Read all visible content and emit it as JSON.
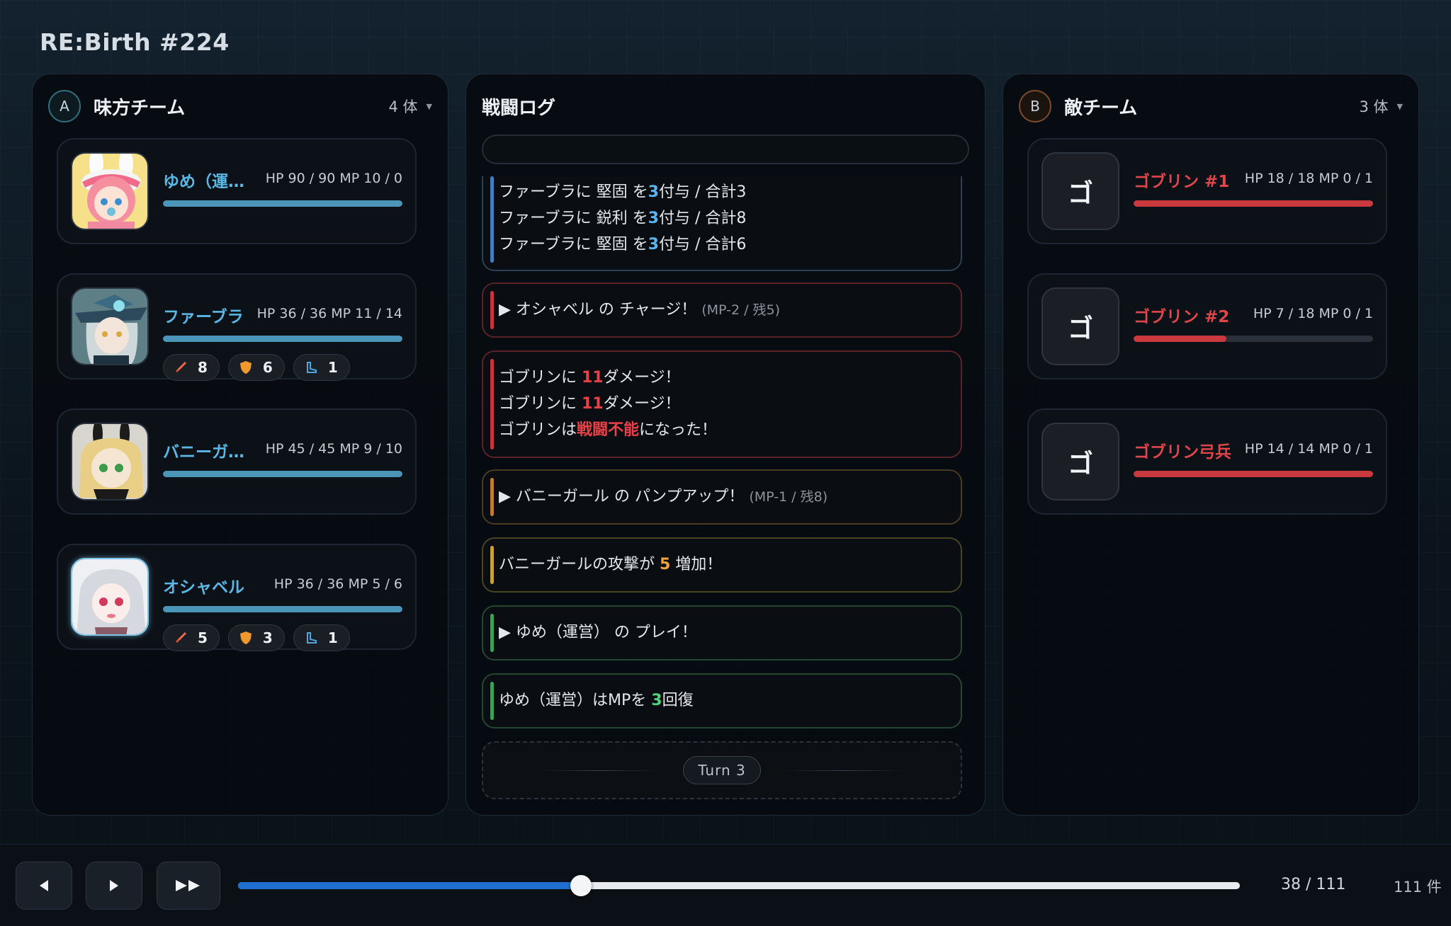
{
  "app": {
    "title": "RE:Birth #224"
  },
  "ally_team": {
    "badge": "A",
    "title": "味方チーム",
    "count": "4 体",
    "units": [
      {
        "name": "ゆめ（運…",
        "stats": "HP 90 / 90 MP 10 / 0",
        "hp_fraction": 1.0,
        "buffs": []
      },
      {
        "name": "ファーブラ",
        "stats": "HP 36 / 36 MP 11 / 14",
        "hp_fraction": 1.0,
        "buffs": [
          {
            "icon": "sword-icon",
            "value": "8"
          },
          {
            "icon": "shield-icon",
            "value": "6"
          },
          {
            "icon": "boot-icon",
            "value": "1"
          }
        ]
      },
      {
        "name": "バニーガ…",
        "stats": "HP 45 / 45 MP 9 / 10",
        "hp_fraction": 1.0,
        "buffs": []
      },
      {
        "name": "オシャベル",
        "stats": "HP 36 / 36 MP 5 / 6",
        "hp_fraction": 1.0,
        "buffs": [
          {
            "icon": "sword-icon",
            "value": "5"
          },
          {
            "icon": "shield-icon",
            "value": "3"
          },
          {
            "icon": "boot-icon",
            "value": "1"
          }
        ]
      }
    ]
  },
  "enemy_team": {
    "badge": "B",
    "title": "敵チーム",
    "count": "3 体",
    "units": [
      {
        "portrait_glyph": "ゴ",
        "name": "ゴブリン #1",
        "stats": "HP 18 / 18 MP 0 / 1",
        "hp_fraction": 1.0
      },
      {
        "portrait_glyph": "ゴ",
        "name": "ゴブリン #2",
        "stats": "HP 7 / 18 MP 0 / 1",
        "hp_fraction": 0.389
      },
      {
        "portrait_glyph": "ゴ",
        "name": "ゴブリン弓兵",
        "stats": "HP 14 / 14 MP 0 / 1",
        "hp_fraction": 1.0
      }
    ]
  },
  "battle_log": {
    "title": "戦闘ログ",
    "entries": [
      {
        "lines": [
          [
            "ファーブラに 堅固 を",
            "3",
            "付与 / 合計3"
          ],
          [
            "ファーブラに 鋭利 を",
            "3",
            "付与 / 合計8"
          ],
          [
            "ファーブラに 堅固 を",
            "3",
            "付与 / 合計6"
          ]
        ]
      },
      {
        "prefix": "▶ オシャベル の チャージ！",
        "note": "(MP-2 / 残5)"
      },
      {
        "lines": [
          [
            "ゴブリンに ",
            "11",
            "ダメージ！"
          ],
          [
            "ゴブリンに ",
            "11",
            "ダメージ！"
          ],
          [
            "ゴブリンは",
            "戦闘不能",
            "になった！"
          ]
        ]
      },
      {
        "prefix": "▶ バニーガール の パンプアップ！",
        "note": "(MP-1 / 残8)"
      },
      {
        "line": [
          "バニーガールの攻撃が ",
          "5",
          " 増加！"
        ]
      },
      {
        "prefix": "▶ ゆめ（運営） の プレイ！"
      },
      {
        "line": [
          "ゆめ（運営）はMPを ",
          "3",
          "回復"
        ]
      }
    ],
    "turn_label": "Turn 3"
  },
  "player": {
    "position": "38 / 111",
    "total": "111 件",
    "current_index": 38,
    "total_count": 111
  },
  "colors": {
    "ally_accent": "#5ab8e6",
    "enemy_accent": "#e0454a",
    "progress": "#1f6fd1"
  }
}
